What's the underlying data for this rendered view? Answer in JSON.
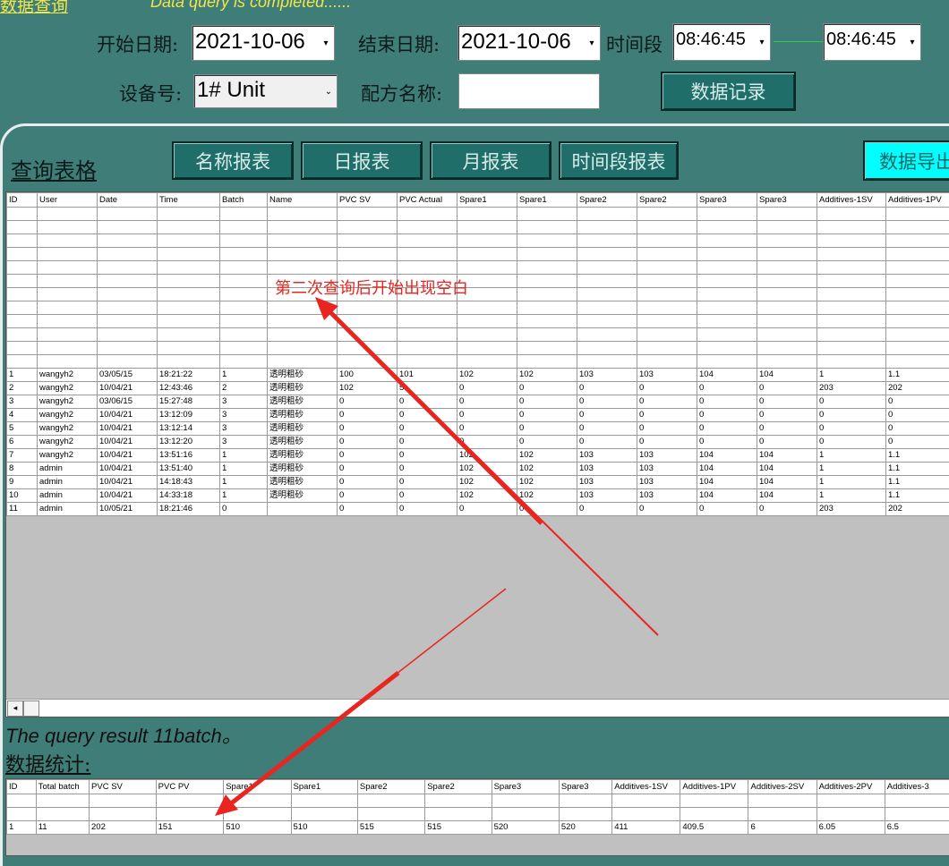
{
  "header": {
    "title_link": "数据查询",
    "status_text": "Data query is completed......"
  },
  "filters": {
    "start_date_label": "开始日期:",
    "start_date_value": "2021-10-06",
    "end_date_label": "结束日期:",
    "end_date_value": "2021-10-06",
    "time_period_label": "时间段",
    "time_from_value": "08:46:45",
    "time_to_value": "08:46:45",
    "device_label": "设备号:",
    "device_value": "1# Unit",
    "recipe_label": "配方名称:",
    "recipe_value": "",
    "data_record_button": "数据记录"
  },
  "query_section": {
    "title": "查询表格",
    "buttons": [
      "名称报表",
      "日报表",
      "月报表",
      "时间段报表",
      "数据导出"
    ]
  },
  "main_table": {
    "columns": [
      "ID",
      "User",
      "Date",
      "Time",
      "Batch",
      "Name",
      "PVC SV",
      "PVC Actual",
      "Spare1",
      "Spare1",
      "Spare2",
      "Spare2",
      "Spare3",
      "Spare3",
      "Additives-1SV",
      "Additives-1PV"
    ],
    "rows": [
      [
        "1",
        "wangyh2",
        "03/05/15",
        "18:21:22",
        "1",
        "透明粗砂",
        "100",
        "101",
        "102",
        "102",
        "103",
        "103",
        "104",
        "104",
        "1",
        "1.1"
      ],
      [
        "2",
        "wangyh2",
        "10/04/21",
        "12:43:46",
        "2",
        "透明粗砂",
        "102",
        "5",
        "0",
        "0",
        "0",
        "0",
        "0",
        "0",
        "203",
        "202"
      ],
      [
        "3",
        "wangyh2",
        "03/06/15",
        "15:27:48",
        "3",
        "透明粗砂",
        "0",
        "0",
        "0",
        "0",
        "0",
        "0",
        "0",
        "0",
        "0",
        "0"
      ],
      [
        "4",
        "wangyh2",
        "10/04/21",
        "13:12:09",
        "3",
        "透明粗砂",
        "0",
        "0",
        "0",
        "0",
        "0",
        "0",
        "0",
        "0",
        "0",
        "0"
      ],
      [
        "5",
        "wangyh2",
        "10/04/21",
        "13:12:14",
        "3",
        "透明粗砂",
        "0",
        "0",
        "0",
        "0",
        "0",
        "0",
        "0",
        "0",
        "0",
        "0"
      ],
      [
        "6",
        "wangyh2",
        "10/04/21",
        "13:12:20",
        "3",
        "透明粗砂",
        "0",
        "0",
        "0",
        "0",
        "0",
        "0",
        "0",
        "0",
        "0",
        "0"
      ],
      [
        "7",
        "wangyh2",
        "10/04/21",
        "13:51:16",
        "1",
        "透明粗砂",
        "0",
        "0",
        "102",
        "102",
        "103",
        "103",
        "104",
        "104",
        "1",
        "1.1"
      ],
      [
        "8",
        "admin",
        "10/04/21",
        "13:51:40",
        "1",
        "透明粗砂",
        "0",
        "0",
        "102",
        "102",
        "103",
        "103",
        "104",
        "104",
        "1",
        "1.1"
      ],
      [
        "9",
        "admin",
        "10/04/21",
        "14:18:43",
        "1",
        "透明粗砂",
        "0",
        "0",
        "102",
        "102",
        "103",
        "103",
        "104",
        "104",
        "1",
        "1.1"
      ],
      [
        "10",
        "admin",
        "10/04/21",
        "14:33:18",
        "1",
        "透明粗砂",
        "0",
        "0",
        "102",
        "102",
        "103",
        "103",
        "104",
        "104",
        "1",
        "1.1"
      ],
      [
        "11",
        "admin",
        "10/05/21",
        "18:21:46",
        "0",
        "",
        "0",
        "0",
        "0",
        "0",
        "0",
        "0",
        "0",
        "0",
        "203",
        "202"
      ]
    ]
  },
  "annotation": {
    "text": "第二次查询后开始出现空白"
  },
  "query_result_text": "The query result 11batch。",
  "stats_title": "数据统计:",
  "stats_table": {
    "columns": [
      "ID",
      "Total batch",
      "PVC SV",
      "PVC PV",
      "Spare1",
      "Spare1",
      "Spare2",
      "Spare2",
      "Spare3",
      "Spare3",
      "Additives-1SV",
      "Additives-1PV",
      "Additives-2SV",
      "Additives-2PV",
      "Additives-3"
    ],
    "rows": [
      [
        "1",
        "11",
        "202",
        "151",
        "510",
        "510",
        "515",
        "515",
        "520",
        "520",
        "411",
        "409.5",
        "6",
        "6.05",
        "6.5"
      ]
    ]
  },
  "colors": {
    "background": "#3f7d78",
    "button": "#1f6e6a",
    "export_button": "#00ffff",
    "status_text": "#f2e64a",
    "annotation": "#e8261f"
  }
}
